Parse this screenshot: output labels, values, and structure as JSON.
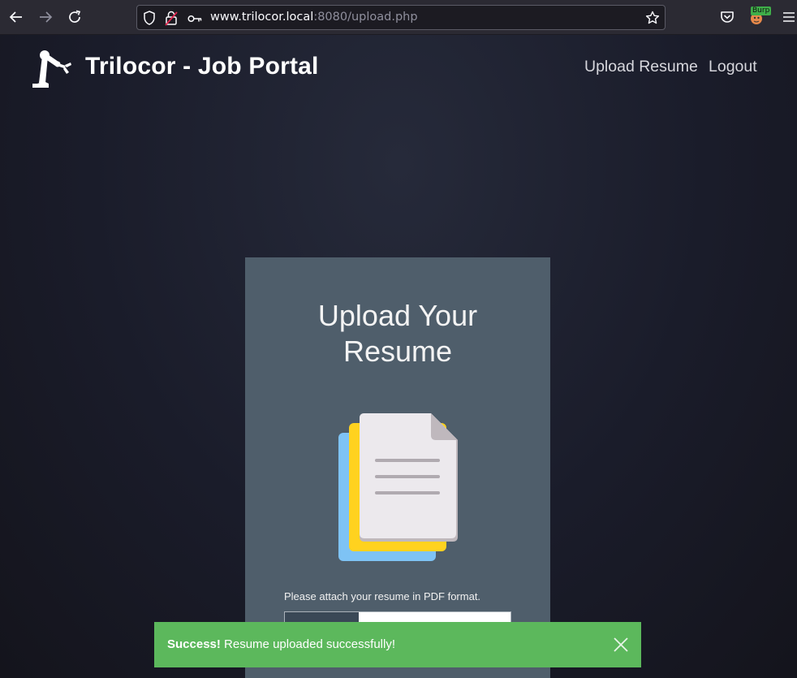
{
  "browser": {
    "url_host": "www.trilocor.local",
    "url_rest": ":8080/upload.php",
    "extension_badge": "Burp"
  },
  "header": {
    "title": "Trilocor - Job Portal",
    "nav": [
      {
        "label": "Upload Resume"
      },
      {
        "label": "Logout"
      }
    ]
  },
  "upload_card": {
    "title_line1": "Upload Your",
    "title_line2": "Resume",
    "instruction": "Please attach your resume in PDF format."
  },
  "toast": {
    "strong": "Success!",
    "message": " Resume uploaded successfully!"
  },
  "colors": {
    "card_bg": "#4f5e6b",
    "toast_success": "#5cb85c",
    "doc_yellow": "#ffd21f",
    "doc_blue": "#7ec3f5"
  },
  "icons": [
    "back-arrow-icon",
    "forward-arrow-icon",
    "reload-icon",
    "shield-icon",
    "permissions-icon",
    "key-icon",
    "bookmark-star-icon",
    "pocket-icon",
    "burp-extension-icon",
    "menu-icon",
    "robot-arm-logo",
    "document-stack-icon",
    "close-icon"
  ]
}
